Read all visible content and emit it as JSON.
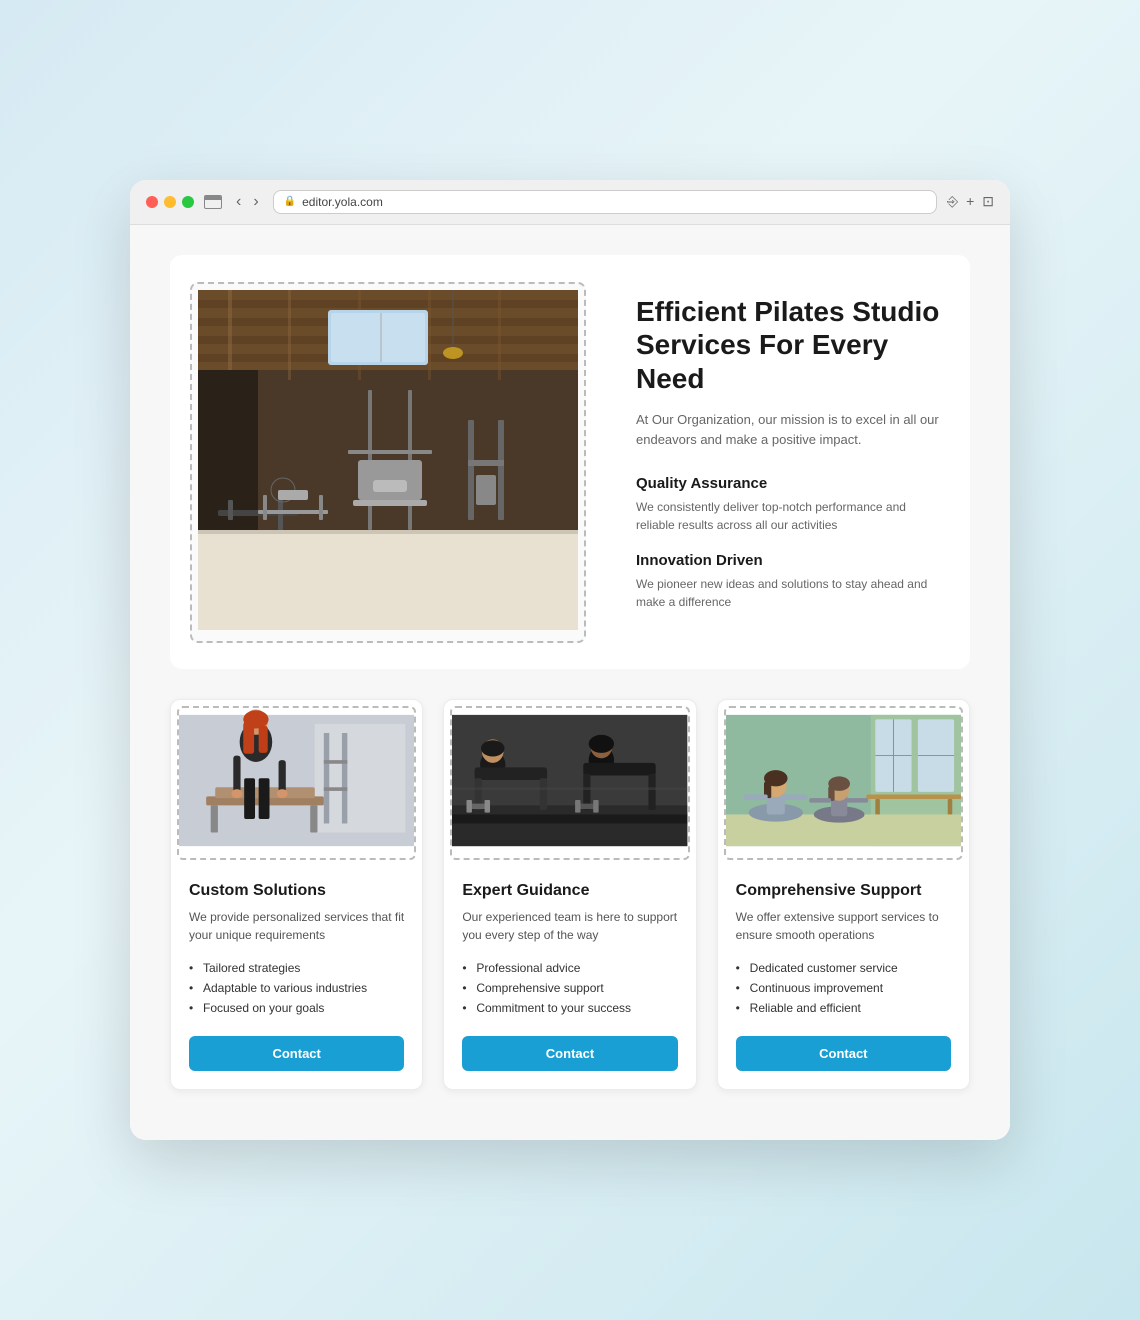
{
  "browser": {
    "url": "editor.yola.com",
    "tab_icon": "browser-tab",
    "back_btn": "‹",
    "forward_btn": "›"
  },
  "hero": {
    "title": "Efficient Pilates Studio Services For Every Need",
    "subtitle": "At Our Organization, our mission is to excel in all our endeavors and make a positive impact.",
    "features": [
      {
        "title": "Quality Assurance",
        "desc": "We consistently deliver top-notch performance and reliable results across all our activities"
      },
      {
        "title": "Innovation Driven",
        "desc": "We pioneer new ideas and solutions to stay ahead and make a difference"
      }
    ]
  },
  "cards": [
    {
      "title": "Custom Solutions",
      "desc": "We provide personalized services that fit your unique requirements",
      "list": [
        "Tailored strategies",
        "Adaptable to various industries",
        "Focused on your goals"
      ],
      "btn_label": "Contact"
    },
    {
      "title": "Expert Guidance",
      "desc": "Our experienced team is here to support you every step of the way",
      "list": [
        "Professional advice",
        "Comprehensive support",
        "Commitment to your success"
      ],
      "btn_label": "Contact"
    },
    {
      "title": "Comprehensive Support",
      "desc": "We offer extensive support services to ensure smooth operations",
      "list": [
        "Dedicated customer service",
        "Continuous improvement",
        "Reliable and efficient"
      ],
      "btn_label": "Contact"
    }
  ]
}
